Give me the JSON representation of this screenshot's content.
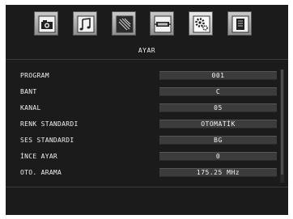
{
  "header": {
    "subtitle": "AYAR",
    "tabs": [
      {
        "icon": "camera-icon"
      },
      {
        "icon": "music-note-icon"
      },
      {
        "icon": "picture-icon"
      },
      {
        "icon": "connection-icon"
      },
      {
        "icon": "settings-gear-icon",
        "active": true
      },
      {
        "icon": "document-icon"
      }
    ]
  },
  "menu": {
    "rows": [
      {
        "label": "PROGRAM",
        "value": "001"
      },
      {
        "label": "BANT",
        "value": "C"
      },
      {
        "label": "KANAL",
        "value": "05"
      },
      {
        "label": "RENK STANDARDI",
        "value": "OTOMATİK"
      },
      {
        "label": "SES STANDARDI",
        "value": "BG"
      },
      {
        "label": "İNCE AYAR",
        "value": "0"
      },
      {
        "label": "OTO. ARAMA",
        "value": "175.25  MHz"
      }
    ]
  }
}
